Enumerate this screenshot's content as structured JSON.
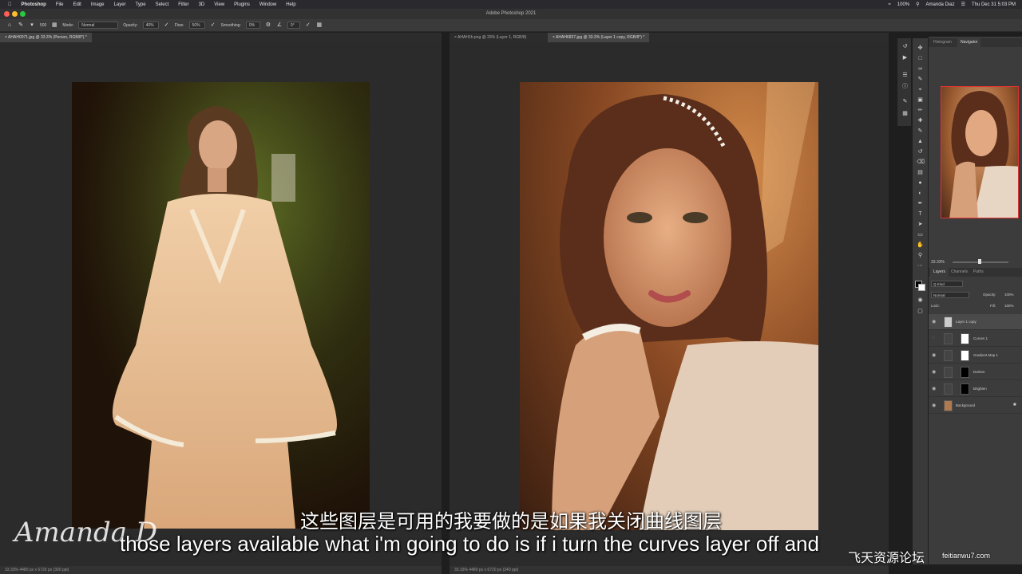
{
  "menubar": {
    "apple": "",
    "app": "Photoshop",
    "items": [
      "File",
      "Edit",
      "Image",
      "Layer",
      "Type",
      "Select",
      "Filter",
      "3D",
      "View",
      "Plugins",
      "Window",
      "Help"
    ],
    "battery": "100%",
    "user": "Amanda Diaz",
    "clock": "Thu Dec 31  5:03 PM"
  },
  "window": {
    "title": "Adobe Photoshop 2021"
  },
  "options": {
    "mode_label": "Mode:",
    "mode_value": "Normal",
    "opacity_label": "Opacity:",
    "opacity_value": "40%",
    "flow_label": "Flow:",
    "flow_value": "50%",
    "smoothing_label": "Smoothing:",
    "smoothing_value": "0%",
    "angle_value": "0°",
    "brush_size": "500"
  },
  "documents": {
    "left_tab": "AHAH0071.jpg @ 33.3% (Person, RGB/8*) *",
    "right_tabs": [
      {
        "label": "AHAH1h.png @ 33% (Layer 1, RGB/8)",
        "active": false
      },
      {
        "label": "AHAH6827.jpg @ 33.3% (Layer 1 copy, RGB/8*) *",
        "active": true
      }
    ],
    "left_status": "33.33%    4480 px x 6720 px (300 ppi)",
    "right_status": "33.33%    4480 px x 6720 px (240 ppi)"
  },
  "panel": {
    "top_tabs": [
      "Histogram",
      "Navigator"
    ],
    "zoom": "33.33%",
    "layer_tabs": [
      "Layers",
      "Channels",
      "Paths"
    ],
    "kind_label": "Q Kind",
    "blend_mode": "Normal",
    "opacity_label": "Opacity:",
    "opacity_value": "100%",
    "lock_label": "Lock:",
    "fill_label": "Fill:",
    "fill_value": "100%",
    "layers": [
      {
        "name": "Layer 1 copy",
        "selected": true
      },
      {
        "name": "Curves 1",
        "selected": false
      },
      {
        "name": "Gradient Map 1",
        "selected": false
      },
      {
        "name": "Darken",
        "selected": false
      },
      {
        "name": "Brighten",
        "selected": false
      },
      {
        "name": "Background",
        "selected": false
      }
    ]
  },
  "subtitles": {
    "chinese": "这些图层是可用的我要做的是如果我关闭曲线图层",
    "english": "those layers available what i'm going to do is if i turn the curves layer off and"
  },
  "watermarks": {
    "signature": "Amanda D",
    "site": "飞天资源论坛",
    "url": "feitianwu7.com"
  },
  "colors": {
    "menubar": "#2a2a2e",
    "canvas_bg": "#2b2b2b",
    "panel_bg": "#3c3c3c",
    "selected_layer": "#4a4a4a"
  }
}
